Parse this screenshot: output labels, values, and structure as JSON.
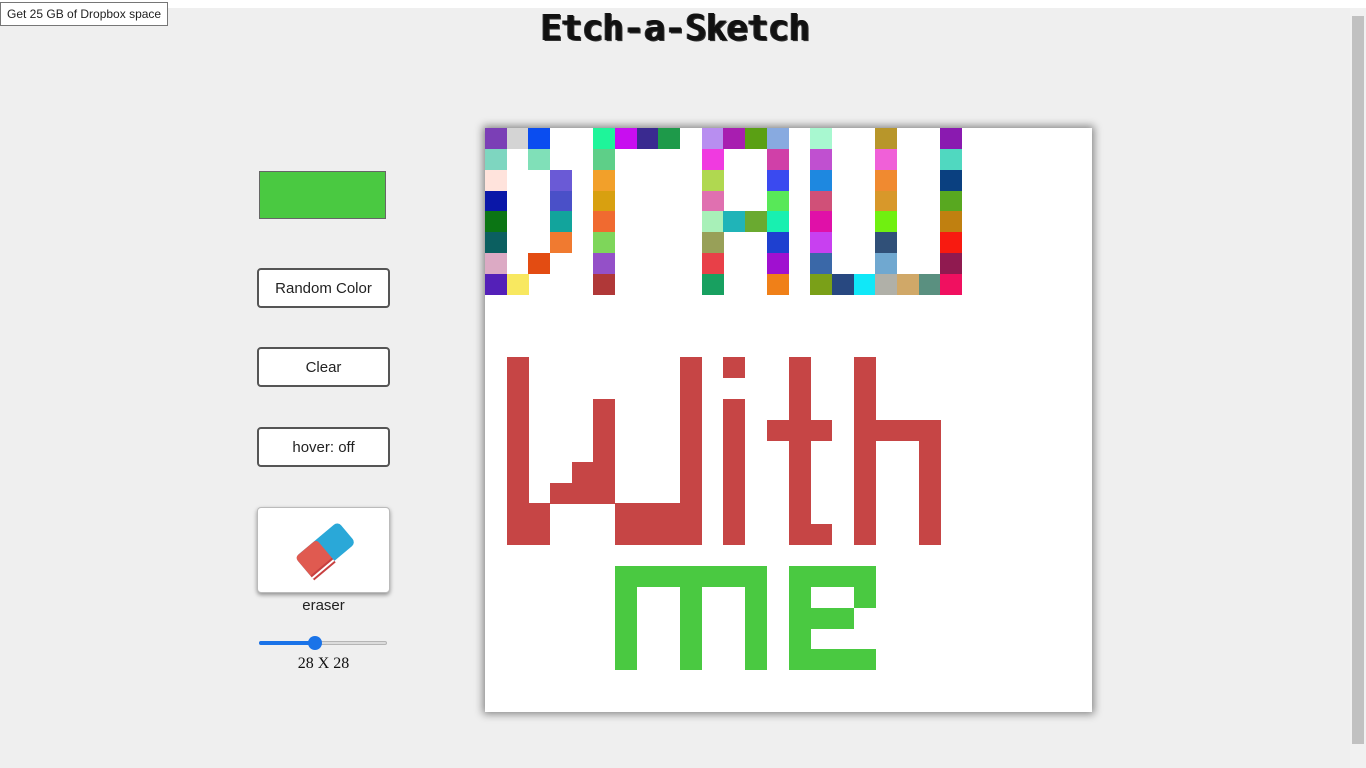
{
  "tooltip": "Get 25 GB of Dropbox space",
  "title": "Etch-a-Sketch",
  "current_color": "#4ac941",
  "buttons": {
    "random": "Random Color",
    "clear": "Clear",
    "hover": "hover: off"
  },
  "eraser": {
    "label": "eraser",
    "icon": "eraser-icon"
  },
  "slider": {
    "value": 28,
    "min": 1,
    "max": 64,
    "fill_fraction": 0.44
  },
  "grid_label": "28 X 28",
  "grid": {
    "size": 28,
    "cells": [
      {
        "r": 0,
        "c": 0,
        "color": "#7b3fb6"
      },
      {
        "r": 0,
        "c": 1,
        "color": "#d4d4d4"
      },
      {
        "r": 0,
        "c": 2,
        "color": "#0a4df0"
      },
      {
        "r": 1,
        "c": 0,
        "color": "#7ed6c0"
      },
      {
        "r": 1,
        "c": 2,
        "color": "#80e0b8"
      },
      {
        "r": 2,
        "c": 0,
        "color": "#ffe3dc"
      },
      {
        "r": 2,
        "c": 3,
        "color": "#6a5ad6"
      },
      {
        "r": 3,
        "c": 0,
        "color": "#0a17a8"
      },
      {
        "r": 3,
        "c": 3,
        "color": "#4a50c8"
      },
      {
        "r": 4,
        "c": 0,
        "color": "#0b7514"
      },
      {
        "r": 4,
        "c": 3,
        "color": "#12a49c"
      },
      {
        "r": 5,
        "c": 0,
        "color": "#0b5f60"
      },
      {
        "r": 5,
        "c": 3,
        "color": "#f07a30"
      },
      {
        "r": 6,
        "c": 0,
        "color": "#dcaac4"
      },
      {
        "r": 6,
        "c": 2,
        "color": "#e34c12"
      },
      {
        "r": 7,
        "c": 0,
        "color": "#5420b8"
      },
      {
        "r": 7,
        "c": 1,
        "color": "#f8e860"
      },
      {
        "r": 0,
        "c": 5,
        "color": "#1ef59a"
      },
      {
        "r": 0,
        "c": 6,
        "color": "#c80ef0"
      },
      {
        "r": 0,
        "c": 7,
        "color": "#3a2a90"
      },
      {
        "r": 0,
        "c": 8,
        "color": "#1e9a4a"
      },
      {
        "r": 1,
        "c": 5,
        "color": "#5ecf88"
      },
      {
        "r": 2,
        "c": 5,
        "color": "#f2a02a"
      },
      {
        "r": 3,
        "c": 5,
        "color": "#d8a010"
      },
      {
        "r": 4,
        "c": 5,
        "color": "#f06a30"
      },
      {
        "r": 5,
        "c": 5,
        "color": "#7ed65a"
      },
      {
        "r": 6,
        "c": 5,
        "color": "#9450c8"
      },
      {
        "r": 7,
        "c": 5,
        "color": "#b03838"
      },
      {
        "r": 0,
        "c": 10,
        "color": "#b88ef0"
      },
      {
        "r": 0,
        "c": 11,
        "color": "#a81eb0"
      },
      {
        "r": 0,
        "c": 12,
        "color": "#5aa014"
      },
      {
        "r": 0,
        "c": 13,
        "color": "#88aae0"
      },
      {
        "r": 1,
        "c": 10,
        "color": "#f03ae0"
      },
      {
        "r": 1,
        "c": 13,
        "color": "#d040a8"
      },
      {
        "r": 2,
        "c": 10,
        "color": "#b0d850"
      },
      {
        "r": 2,
        "c": 13,
        "color": "#3a4af0"
      },
      {
        "r": 3,
        "c": 10,
        "color": "#e070b0"
      },
      {
        "r": 3,
        "c": 13,
        "color": "#58e858"
      },
      {
        "r": 4,
        "c": 10,
        "color": "#a8f0b8"
      },
      {
        "r": 4,
        "c": 11,
        "color": "#20b4b8"
      },
      {
        "r": 4,
        "c": 12,
        "color": "#6aaa30"
      },
      {
        "r": 4,
        "c": 13,
        "color": "#18f0b0"
      },
      {
        "r": 5,
        "c": 10,
        "color": "#98a058"
      },
      {
        "r": 5,
        "c": 13,
        "color": "#1e40d0"
      },
      {
        "r": 6,
        "c": 10,
        "color": "#e84048"
      },
      {
        "r": 6,
        "c": 13,
        "color": "#a010d0"
      },
      {
        "r": 7,
        "c": 10,
        "color": "#18a060"
      },
      {
        "r": 7,
        "c": 13,
        "color": "#f08018"
      },
      {
        "r": 0,
        "c": 15,
        "color": "#a8f8d0"
      },
      {
        "r": 0,
        "c": 18,
        "color": "#b8962a"
      },
      {
        "r": 0,
        "c": 21,
        "color": "#8a1ab0"
      },
      {
        "r": 1,
        "c": 15,
        "color": "#c050d0"
      },
      {
        "r": 1,
        "c": 18,
        "color": "#f060d8"
      },
      {
        "r": 1,
        "c": 21,
        "color": "#50d8c0"
      },
      {
        "r": 2,
        "c": 15,
        "color": "#1e88e0"
      },
      {
        "r": 2,
        "c": 18,
        "color": "#f08a30"
      },
      {
        "r": 2,
        "c": 21,
        "color": "#0a4080"
      },
      {
        "r": 3,
        "c": 15,
        "color": "#d05078"
      },
      {
        "r": 3,
        "c": 18,
        "color": "#d8982a"
      },
      {
        "r": 3,
        "c": 21,
        "color": "#58a820"
      },
      {
        "r": 4,
        "c": 15,
        "color": "#e010a8"
      },
      {
        "r": 4,
        "c": 18,
        "color": "#70f010"
      },
      {
        "r": 4,
        "c": 21,
        "color": "#c08010"
      },
      {
        "r": 5,
        "c": 15,
        "color": "#c840f0"
      },
      {
        "r": 5,
        "c": 18,
        "color": "#305078"
      },
      {
        "r": 5,
        "c": 21,
        "color": "#f81a10"
      },
      {
        "r": 6,
        "c": 15,
        "color": "#3a68a8"
      },
      {
        "r": 6,
        "c": 18,
        "color": "#70a8d0"
      },
      {
        "r": 6,
        "c": 21,
        "color": "#901a50"
      },
      {
        "r": 7,
        "c": 15,
        "color": "#7aa018"
      },
      {
        "r": 7,
        "c": 16,
        "color": "#284880"
      },
      {
        "r": 7,
        "c": 17,
        "color": "#10e8f8"
      },
      {
        "r": 7,
        "c": 18,
        "color": "#b0b0a8"
      },
      {
        "r": 7,
        "c": 19,
        "color": "#d0a868"
      },
      {
        "r": 7,
        "c": 20,
        "color": "#5a9080"
      },
      {
        "r": 7,
        "c": 21,
        "color": "#f01060"
      }
    ],
    "with_color": "#c64545",
    "with_cells": [
      [
        11,
        1
      ],
      [
        12,
        1
      ],
      [
        13,
        1
      ],
      [
        14,
        1
      ],
      [
        15,
        1
      ],
      [
        16,
        1
      ],
      [
        17,
        1
      ],
      [
        18,
        1
      ],
      [
        19,
        1
      ],
      [
        18,
        2
      ],
      [
        19,
        2
      ],
      [
        17,
        3
      ],
      [
        16,
        4
      ],
      [
        17,
        4
      ],
      [
        13,
        5
      ],
      [
        14,
        5
      ],
      [
        15,
        5
      ],
      [
        16,
        5
      ],
      [
        17,
        5
      ],
      [
        18,
        6
      ],
      [
        19,
        6
      ],
      [
        18,
        7
      ],
      [
        19,
        7
      ],
      [
        18,
        8
      ],
      [
        19,
        8
      ],
      [
        11,
        9
      ],
      [
        12,
        9
      ],
      [
        13,
        9
      ],
      [
        14,
        9
      ],
      [
        15,
        9
      ],
      [
        16,
        9
      ],
      [
        17,
        9
      ],
      [
        18,
        9
      ],
      [
        19,
        9
      ],
      [
        11,
        11
      ],
      [
        13,
        11
      ],
      [
        14,
        11
      ],
      [
        15,
        11
      ],
      [
        16,
        11
      ],
      [
        17,
        11
      ],
      [
        18,
        11
      ],
      [
        19,
        11
      ],
      [
        11,
        14
      ],
      [
        12,
        14
      ],
      [
        13,
        14
      ],
      [
        14,
        14
      ],
      [
        15,
        14
      ],
      [
        16,
        14
      ],
      [
        17,
        14
      ],
      [
        18,
        14
      ],
      [
        19,
        14
      ],
      [
        14,
        13
      ],
      [
        14,
        15
      ],
      [
        19,
        15
      ],
      [
        11,
        17
      ],
      [
        12,
        17
      ],
      [
        13,
        17
      ],
      [
        14,
        17
      ],
      [
        15,
        17
      ],
      [
        16,
        17
      ],
      [
        17,
        17
      ],
      [
        18,
        17
      ],
      [
        19,
        17
      ],
      [
        14,
        18
      ],
      [
        14,
        19
      ],
      [
        14,
        20
      ],
      [
        15,
        20
      ],
      [
        16,
        20
      ],
      [
        17,
        20
      ],
      [
        18,
        20
      ],
      [
        19,
        20
      ]
    ],
    "me_color": "#4ac941",
    "me_cells": [
      [
        21,
        6
      ],
      [
        22,
        6
      ],
      [
        23,
        6
      ],
      [
        24,
        6
      ],
      [
        25,
        6
      ],
      [
        21,
        7
      ],
      [
        21,
        8
      ],
      [
        21,
        9
      ],
      [
        22,
        9
      ],
      [
        23,
        9
      ],
      [
        24,
        9
      ],
      [
        25,
        9
      ],
      [
        21,
        10
      ],
      [
        21,
        11
      ],
      [
        21,
        12
      ],
      [
        22,
        12
      ],
      [
        23,
        12
      ],
      [
        24,
        12
      ],
      [
        25,
        12
      ],
      [
        21,
        14
      ],
      [
        22,
        14
      ],
      [
        23,
        14
      ],
      [
        24,
        14
      ],
      [
        25,
        14
      ],
      [
        21,
        15
      ],
      [
        21,
        16
      ],
      [
        21,
        17
      ],
      [
        23,
        15
      ],
      [
        23,
        16
      ],
      [
        25,
        15
      ],
      [
        25,
        16
      ],
      [
        25,
        17
      ],
      [
        22,
        17
      ]
    ]
  }
}
